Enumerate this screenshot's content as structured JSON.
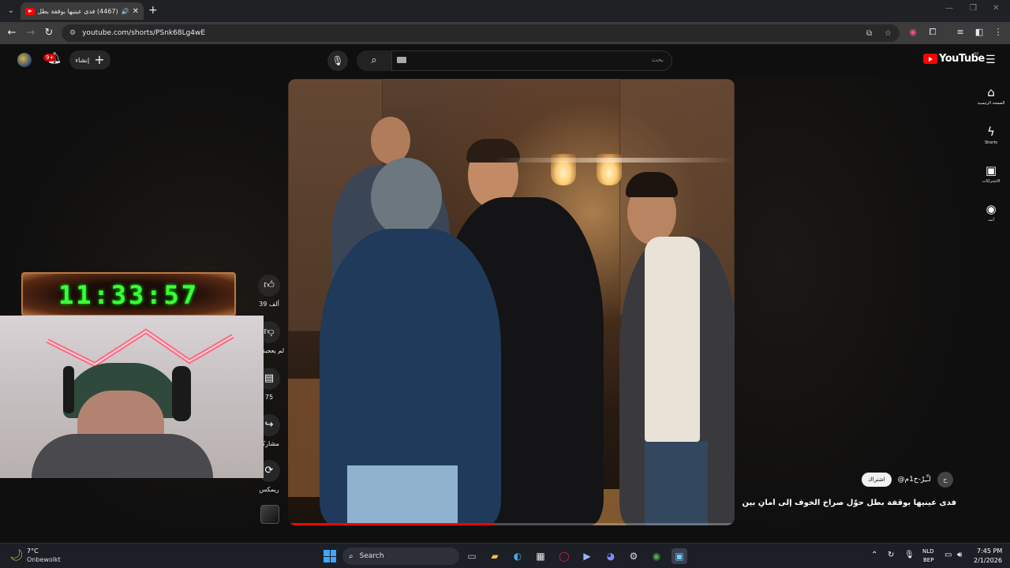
{
  "browser": {
    "tab_title": "(4467) فدى عينيها بوقفة بطل",
    "url": "youtube.com/shorts/PSnk68Lg4wE"
  },
  "masthead": {
    "create_label": "إنشاء",
    "notification_count": "9+",
    "search_placeholder": "بحث",
    "logo_text": "YouTube",
    "region": "BE"
  },
  "guide": [
    {
      "label": "الصفحة الرئيسية",
      "icon": "home-icon"
    },
    {
      "label": "Shorts",
      "icon": "shorts-icon"
    },
    {
      "label": "الاشتراكات",
      "icon": "subscriptions-icon"
    },
    {
      "label": "أنت",
      "icon": "you-icon"
    }
  ],
  "actions": {
    "like_count": "39 ألف",
    "dislike_label": "لم يعجبني",
    "comments_count": "75",
    "share_label": "مشاركة",
    "remix_label": "ريمكس"
  },
  "channel": {
    "name": "@لـِّـِرْ-ح1م",
    "subscribe_label": "اشتراك",
    "avatar_letter": "ح"
  },
  "short": {
    "title": "فدى عينيها بوقفة بطل حوّل صراخ الخوف إلى أمانٍ بين يديه...",
    "progress": 0.46
  },
  "overlay": {
    "clock": "11:33:57"
  },
  "taskbar": {
    "weather_temp": "7°C",
    "weather_desc": "Onbewolkt",
    "search_label": "Search",
    "lang_top": "NLD",
    "lang_bottom": "BEP",
    "time": "7:45 PM",
    "date": "2/1/2026"
  }
}
